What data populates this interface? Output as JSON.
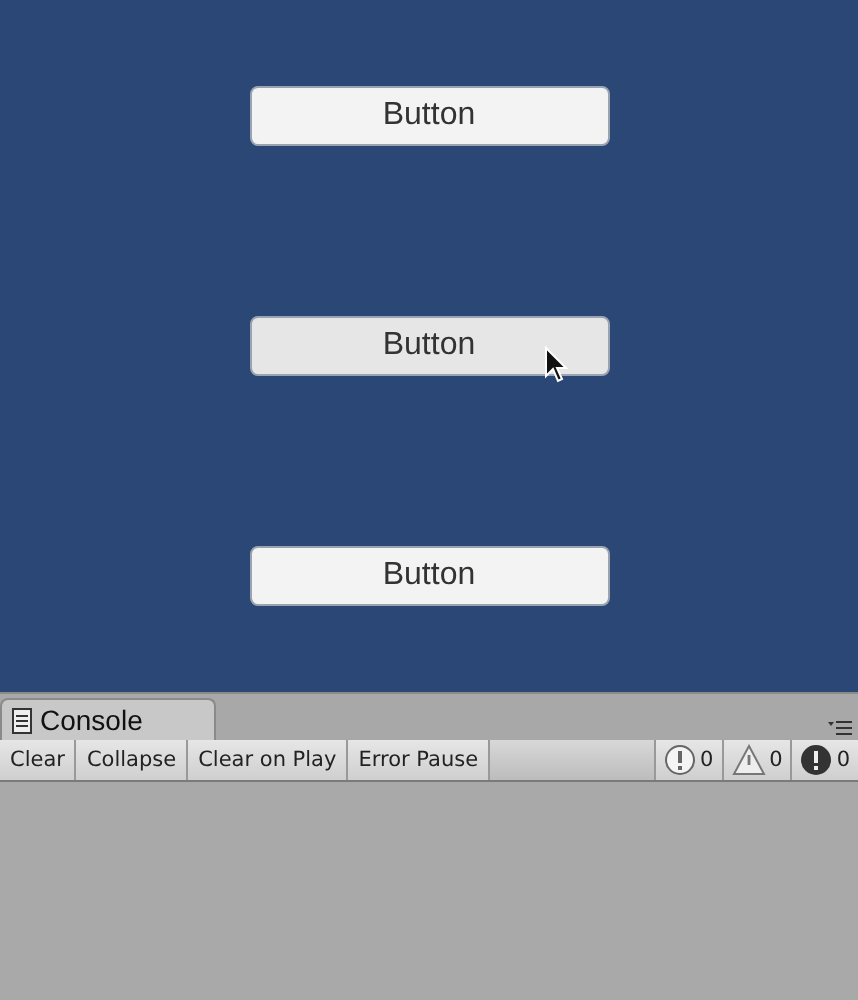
{
  "scene_buttons": [
    {
      "label": "Button",
      "hovered": false
    },
    {
      "label": "Button",
      "hovered": true
    },
    {
      "label": "Button",
      "hovered": false
    }
  ],
  "console": {
    "tab": "Console",
    "toolbar": [
      "Clear",
      "Collapse",
      "Clear on Play",
      "Error Pause"
    ],
    "counters": [
      {
        "kind": "info",
        "count": "0"
      },
      {
        "kind": "warning",
        "count": "0"
      },
      {
        "kind": "error",
        "count": "0"
      }
    ]
  }
}
